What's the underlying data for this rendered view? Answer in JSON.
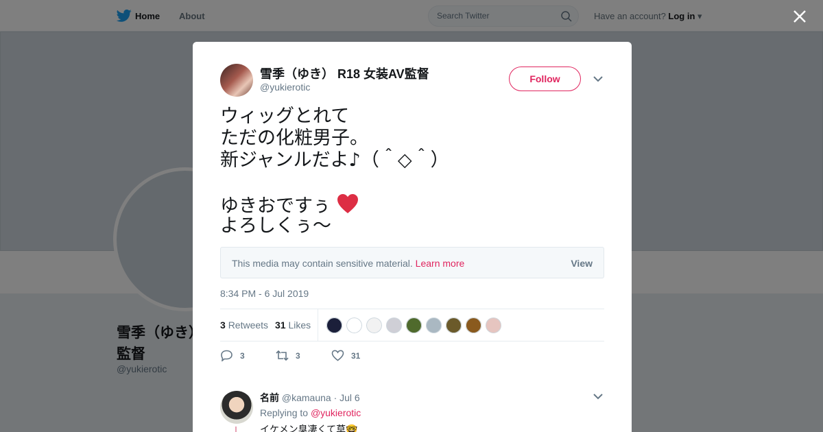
{
  "header": {
    "home_label": "Home",
    "about_label": "About",
    "search_placeholder": "Search Twitter",
    "have_account_text": "Have an account?",
    "login_label": "Log in"
  },
  "profile_bg": {
    "name_line1": "雪季（ゆき）",
    "name_line2": "監督",
    "handle": "@yukierotic"
  },
  "tweet": {
    "author_name": "雪季（ゆき） R18 女装AV監督",
    "author_handle": "@yukierotic",
    "follow_label": "Follow",
    "text_lines": [
      "ウィッグとれて",
      "ただの化粧男子。",
      "新ジャンルだよ♪（＾◇＾）",
      "",
      "ゆきおですぅ",
      "よろしくぅ～"
    ],
    "sensitive_text": "This media may contain sensitive material.",
    "learn_more_label": "Learn more",
    "view_label": "View",
    "timestamp": "8:34 PM - 6 Jul 2019",
    "retweets_count": "3",
    "retweets_label": "Retweets",
    "likes_count": "31",
    "likes_label": "Likes",
    "liker_colors": [
      "#1b1f3a",
      "#ffffff",
      "#f2f2f2",
      "#cfcfd6",
      "#4f6a2c",
      "#aab8c2",
      "#6b5a2a",
      "#8a5a1e",
      "#e6c5c0"
    ],
    "action_reply_count": "3",
    "action_retweet_count": "3",
    "action_like_count": "31"
  },
  "reply": {
    "name": "名前",
    "handle": "@kamauna",
    "date": "· Jul 6",
    "replying_label": "Replying to",
    "replying_to": "@yukierotic",
    "text": "イケメン臭凄くて草🤓"
  },
  "colors": {
    "accent": "#e0245e",
    "twitter_blue": "#1da1f2",
    "muted": "#657786"
  }
}
